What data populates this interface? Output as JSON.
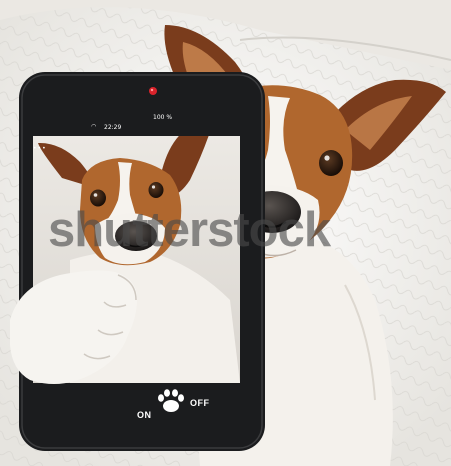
{
  "phone": {
    "status_time": "22:29",
    "status_battery": "100 %",
    "camera_toggle": {
      "on_label": "ON",
      "off_label": "OFF",
      "icon": "paw-icon"
    }
  },
  "watermark": "shutterstock",
  "colors": {
    "background": "#eceae6",
    "phone_body": "#1b1c1e",
    "camera_light": "#d9232b",
    "fur_brown": "#b0672e",
    "fur_white": "#f4f1ec"
  }
}
